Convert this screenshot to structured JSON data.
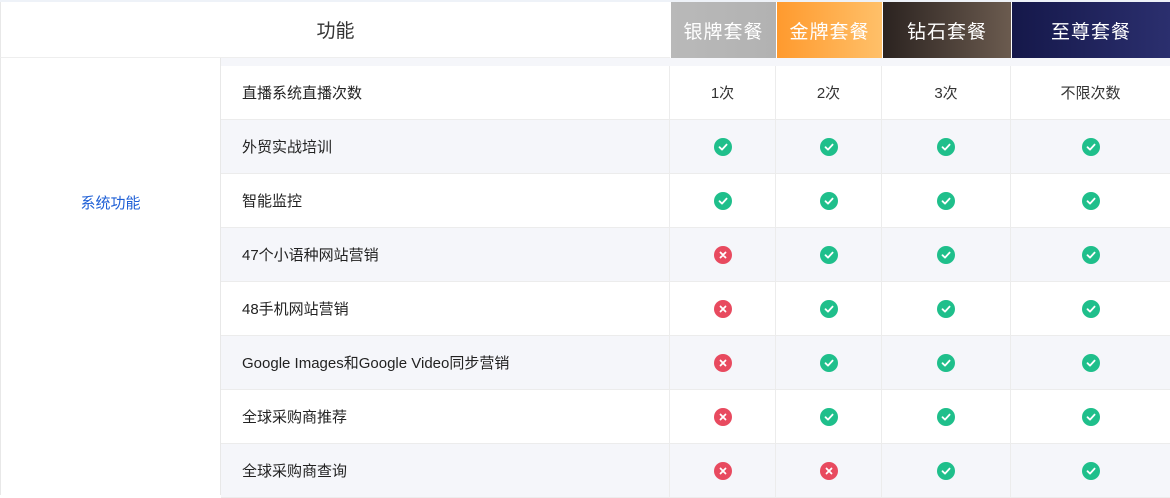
{
  "header": {
    "feature_label": "功能",
    "plans": [
      "银牌套餐",
      "金牌套餐",
      "钻石套餐",
      "至尊套餐"
    ]
  },
  "category": "系统功能",
  "rows": [
    {
      "name": "直播系统直播次数",
      "cells": [
        "1次",
        "2次",
        "3次",
        "不限次数"
      ]
    },
    {
      "name": "外贸实战培训",
      "cells": [
        "check",
        "check",
        "check",
        "check"
      ]
    },
    {
      "name": "智能监控",
      "cells": [
        "check",
        "check",
        "check",
        "check"
      ]
    },
    {
      "name": "47个小语种网站营销",
      "cells": [
        "cross",
        "check",
        "check",
        "check"
      ]
    },
    {
      "name": "48手机网站营销",
      "cells": [
        "cross",
        "check",
        "check",
        "check"
      ]
    },
    {
      "name": "Google Images和Google Video同步营销",
      "cells": [
        "cross",
        "check",
        "check",
        "check"
      ]
    },
    {
      "name": "全球采购商推荐",
      "cells": [
        "cross",
        "check",
        "check",
        "check"
      ]
    },
    {
      "name": "全球采购商查询",
      "cells": [
        "cross",
        "cross",
        "check",
        "check"
      ]
    }
  ],
  "colors": {
    "check": "#1fbf8b",
    "cross": "#e84a5f",
    "category": "#1e5fd6"
  }
}
